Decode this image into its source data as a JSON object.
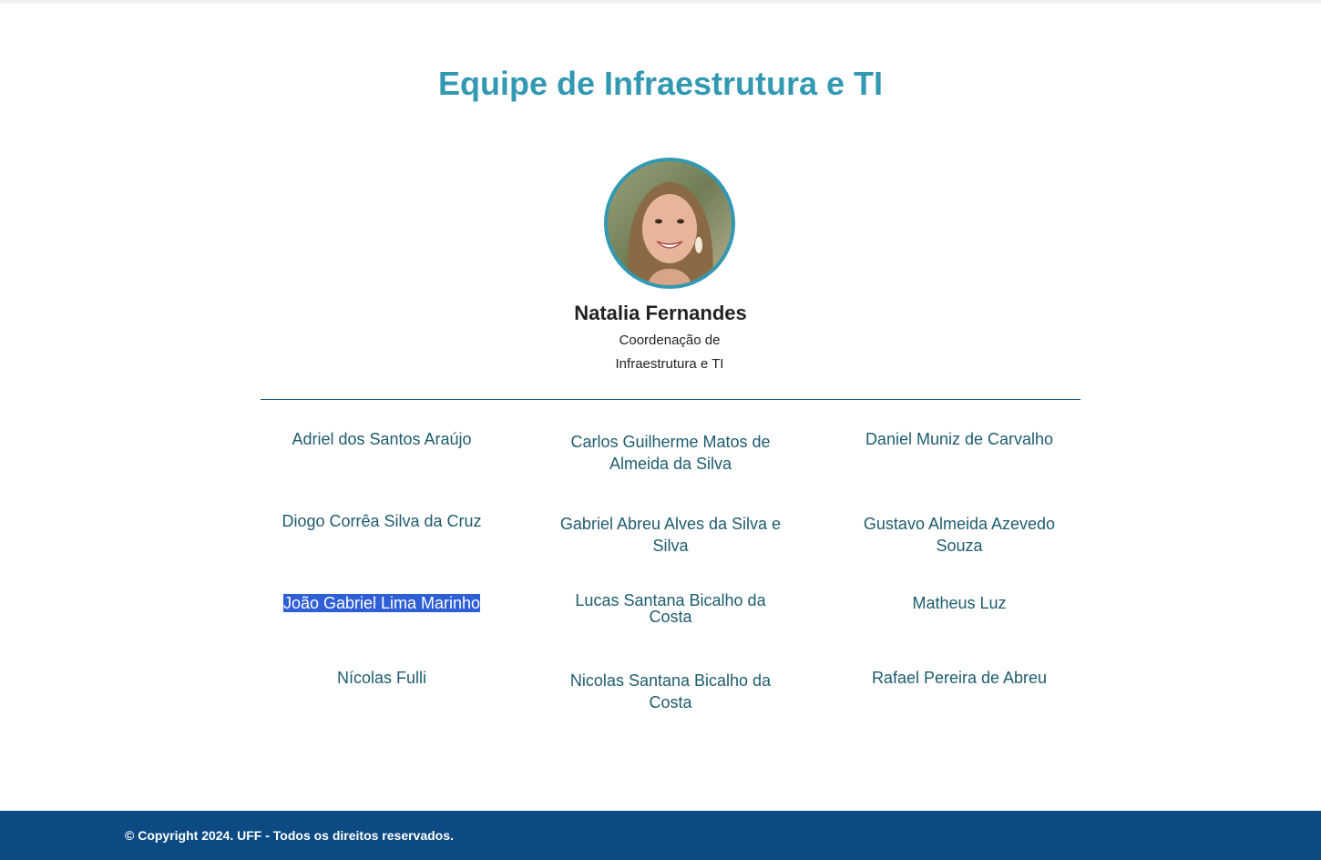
{
  "page": {
    "title": "Equipe de Infraestrutura e TI"
  },
  "leader": {
    "name": "Natalia Fernandes",
    "role": "Coordenação de Infraestrutura e TI"
  },
  "members": [
    [
      "Adriel dos Santos Araújo",
      "Carlos Guilherme Matos de Almeida da Silva",
      "Daniel Muniz de Carvalho"
    ],
    [
      "Diogo Corrêa Silva da Cruz",
      "Gabriel Abreu Alves da Silva e Silva",
      "Gustavo Almeida Azevedo Souza"
    ],
    [
      "João Gabriel Lima Marinho",
      "Lucas Santana Bicalho da Costa",
      "Matheus Luz"
    ],
    [
      "Nícolas Fulli",
      "Nicolas Santana Bicalho da Costa",
      "Rafael Pereira de Abreu"
    ]
  ],
  "selected_member": "João Gabriel Lima Marinho",
  "footer": {
    "text": "© Copyright 2024. UFF - Todos os direitos reservados."
  },
  "colors": {
    "accent": "#3399b3",
    "member_text": "#1d5c6e",
    "footer_bg": "#0b4a82",
    "selection": "#2f5fd6"
  },
  "icons": {
    "leader_photo": "person-avatar-photo"
  }
}
